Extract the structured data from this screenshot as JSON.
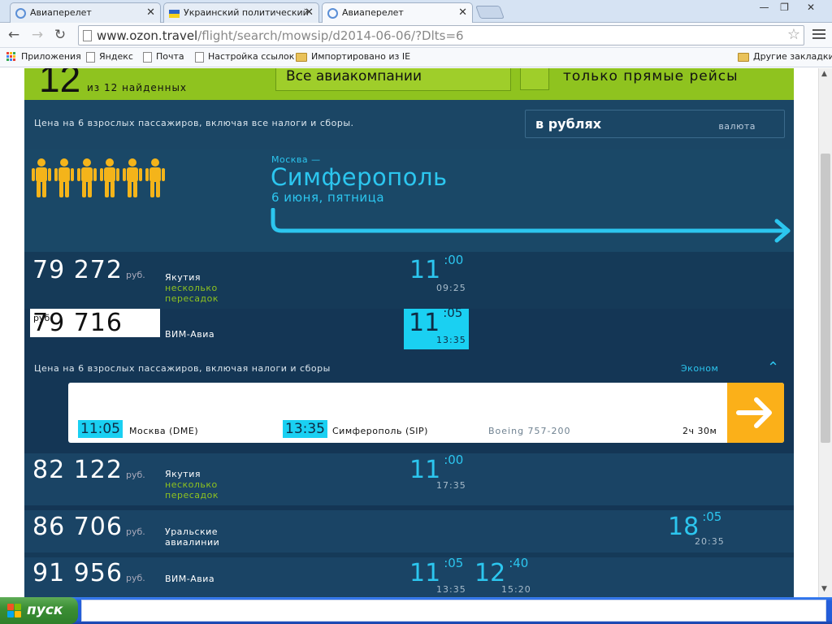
{
  "browser": {
    "tabs": [
      {
        "title": "Авиаперелет",
        "active": false
      },
      {
        "title": "Украинский политический",
        "active": false
      },
      {
        "title": "Авиаперелет",
        "active": true
      }
    ],
    "url_host": "www.ozon.travel",
    "url_path": "/flight/search/mowsip/d2014-06-06/?Dlts=6",
    "bookmarks": [
      "Приложения",
      "Яндекс",
      "Почта",
      "Настройка ссылок",
      "Импортировано из IE"
    ],
    "other_bookmarks": "Другие закладки"
  },
  "filters": {
    "count": "12",
    "found_text": "из 12 найденных",
    "airlines": "Все авиакомпании",
    "direct_only": "только прямые рейсы"
  },
  "price_note": "Цена на 6 взрослых пассажиров, включая все налоги и сборы.",
  "currency": {
    "value": "в рублях",
    "label": "валюта"
  },
  "passengers": 6,
  "route": {
    "from": "Москва —",
    "to": "Симферополь",
    "date": "6 июня, пятница"
  },
  "flights": [
    {
      "price": "79 272",
      "currency": "руб.",
      "airline": "Якутия",
      "transfers": "несколько пересадок",
      "dep_h": "11",
      "dep_m": ":00",
      "arr": "09:25"
    },
    {
      "price": "79 716",
      "currency": "руб.",
      "airline": "ВИМ-Авиа",
      "dep_h": "11",
      "dep_m": ":05",
      "arr": "13:35"
    },
    {
      "price": "82 122",
      "currency": "руб.",
      "airline": "Якутия",
      "transfers": "несколько пересадок",
      "dep_h": "11",
      "dep_m": ":00",
      "arr": "17:35"
    },
    {
      "price": "86 706",
      "currency": "руб.",
      "airline_line1": "Уральские",
      "airline_line2": "авиалинии",
      "dep_h": "18",
      "dep_m": ":05",
      "arr": "20:35"
    },
    {
      "price": "91 956",
      "currency": "руб.",
      "airline": "ВИМ-Авиа",
      "dep_h": "11",
      "dep_m": ":05",
      "arr": "13:35",
      "dep2_h": "12",
      "dep2_m": ":40",
      "arr2": "15:20"
    }
  ],
  "detail": {
    "note": "Цена на 6 взрослых пассажиров, включая налоги и сборы",
    "class": "Эконом",
    "dep_time": "11:05",
    "dep_airport": "Москва (DME)",
    "arr_time": "13:35",
    "arr_airport": "Симферополь (SIP)",
    "aircraft": "Boeing 757-200",
    "duration": "2ч 30м"
  },
  "taskbar": {
    "start": "пуск"
  },
  "colors": {
    "accent": "#2cc6ef",
    "green": "#8fc31f",
    "navy": "#153a58",
    "orange": "#fbb019"
  }
}
